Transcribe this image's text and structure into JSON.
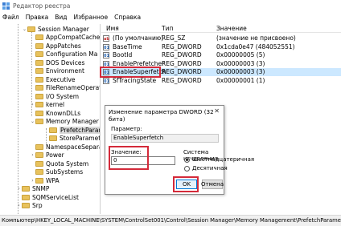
{
  "window": {
    "title": "Редактор реестра"
  },
  "menu": [
    "Файл",
    "Правка",
    "Вид",
    "Избранное",
    "Справка"
  ],
  "tree": {
    "items": [
      {
        "label": "Session Manager",
        "expander": "⌄"
      },
      {
        "label": "AppCompatCache",
        "expander": ""
      },
      {
        "label": "AppPatches",
        "expander": ""
      },
      {
        "label": "Configuration Ma",
        "expander": ""
      },
      {
        "label": "DOS Devices",
        "expander": ""
      },
      {
        "label": "Environment",
        "expander": ""
      },
      {
        "label": "Executive",
        "expander": ""
      },
      {
        "label": "FileRenameOperat",
        "expander": ""
      },
      {
        "label": "I/O System",
        "expander": ""
      },
      {
        "label": "kernel",
        "expander": "›"
      },
      {
        "label": "KnownDLLs",
        "expander": ""
      },
      {
        "label": "Memory Manager",
        "expander": "⌄"
      },
      {
        "label": "PrefetchParar",
        "expander": ""
      },
      {
        "label": "StoreParamete",
        "expander": ""
      },
      {
        "label": "NamespaceSepara",
        "expander": ""
      },
      {
        "label": "Power",
        "expander": "›"
      },
      {
        "label": "Quota System",
        "expander": ""
      },
      {
        "label": "SubSystems",
        "expander": ""
      },
      {
        "label": "WPA",
        "expander": "›"
      },
      {
        "label": "SNMP",
        "expander": "›"
      },
      {
        "label": "SQMServiceList",
        "expander": ""
      },
      {
        "label": "Srp",
        "expander": "›"
      }
    ]
  },
  "list": {
    "columns": {
      "name": "Имя",
      "type": "Тип",
      "value": "Значение"
    },
    "rows": [
      {
        "icon": "ab",
        "name": "(По умолчанию)",
        "type": "REG_SZ",
        "value": "(значение не присвоено)"
      },
      {
        "icon": "01",
        "name": "BaseTime",
        "type": "REG_DWORD",
        "value": "0x1cda0e47 (484052551)"
      },
      {
        "icon": "01",
        "name": "BootId",
        "type": "REG_DWORD",
        "value": "0x00000005 (5)"
      },
      {
        "icon": "01",
        "name": "EnablePrefetcher",
        "type": "REG_DWORD",
        "value": "0x00000003 (3)"
      },
      {
        "icon": "01",
        "name": "EnableSuperfetch",
        "type": "REG_DWORD",
        "value": "0x00000003 (3)"
      },
      {
        "icon": "01",
        "name": "SfTracingState",
        "type": "REG_DWORD",
        "value": "0x00000001 (1)"
      }
    ]
  },
  "dialog": {
    "title": "Изменение параметра DWORD (32 бита)",
    "close": "✕",
    "param_label": "Параметр:",
    "param_value": "EnableSuperfetch",
    "value_label": "Значение:",
    "value": "0",
    "base_label": "Система исчисления",
    "hex_label": "Шестнадцатеричная",
    "dec_label": "Десятичная",
    "ok": "OK",
    "cancel": "Отмена"
  },
  "status": "Компьютер\\HKEY_LOCAL_MACHINE\\SYSTEM\\ControlSet001\\Control\\Session Manager\\Memory Management\\PrefetchParameters",
  "colors": {
    "highlight": "#d42a3a",
    "selection": "#cce8ff",
    "accent": "#0078d7"
  }
}
